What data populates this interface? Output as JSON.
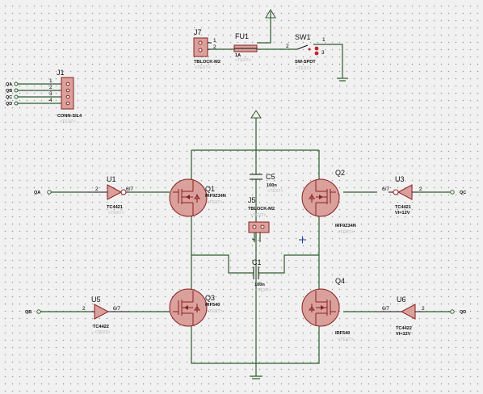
{
  "colors": {
    "background": "#f1f1f1",
    "grid": "#9a9a9a",
    "wire": "#2d5e2d",
    "component_outline": "#8b2020",
    "component_fill": "#d9a09c",
    "placeholder_text": "#b7b7b7"
  },
  "components": {
    "J7": {
      "ref": "J7",
      "value": "TBLOCK-M2",
      "text": "<TEXT>",
      "pins": [
        "1",
        "2"
      ]
    },
    "FU1": {
      "ref": "FU1",
      "value": "1A",
      "text": "<TEXT>"
    },
    "SW1": {
      "ref": "SW1",
      "value": "SW-SPDT",
      "text": "<TEXT>",
      "pins": [
        "1",
        "2",
        "3"
      ]
    },
    "J1": {
      "ref": "J1",
      "value": "CONN-SIL4",
      "text": "<TEXT>",
      "pins": [
        "1",
        "2",
        "3",
        "4"
      ],
      "nets": [
        "QA",
        "QB",
        "QC",
        "QD"
      ]
    },
    "U1": {
      "ref": "U1",
      "value": "TC4421",
      "text": "<TEXT>",
      "in_pin": "2",
      "out_pin": "6/7",
      "net": "QA"
    },
    "U3": {
      "ref": "U3",
      "value": "TC4421",
      "value2": "VI=12V",
      "in_pin": "2",
      "out_pin": "6/7",
      "net": "QC"
    },
    "U5": {
      "ref": "U5",
      "value": "TC4422",
      "text": "<TEXT>",
      "in_pin": "2",
      "out_pin": "6/7",
      "net": "QB"
    },
    "U6": {
      "ref": "U6",
      "value": "TC4422",
      "value2": "VI=12V",
      "in_pin": "2",
      "out_pin": "6/7",
      "net": "QD"
    },
    "Q1": {
      "ref": "Q1",
      "value": "IRF9Z34N",
      "text": "<TEXT>"
    },
    "Q2": {
      "ref": "Q2",
      "value": "IRF9Z34N",
      "text": "<TEXT>"
    },
    "Q3": {
      "ref": "Q3",
      "value": "IRF540",
      "text": "<TEXT>"
    },
    "Q4": {
      "ref": "Q4",
      "value": "IRF540",
      "text": "<TEXT>"
    },
    "C5": {
      "ref": "C5",
      "value": "100n",
      "text": "<TEXT>"
    },
    "C1": {
      "ref": "C1",
      "value": "100n",
      "text": "<TEXT>"
    },
    "J5": {
      "ref": "J5",
      "value": "TBLOCK-M2",
      "text": "<TEXT>",
      "pins": [
        "+",
        "-"
      ]
    }
  }
}
